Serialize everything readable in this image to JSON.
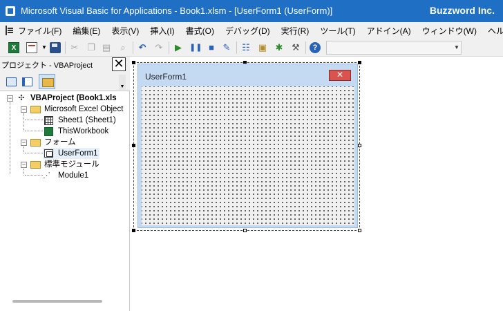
{
  "window": {
    "title": "Microsoft Visual Basic for Applications - Book1.xlsm - [UserForm1 (UserForm)]",
    "brand": "Buzzword Inc."
  },
  "menu": {
    "items": [
      {
        "label": "ファイル(F)"
      },
      {
        "label": "編集(E)"
      },
      {
        "label": "表示(V)"
      },
      {
        "label": "挿入(I)"
      },
      {
        "label": "書式(O)"
      },
      {
        "label": "デバッグ(D)"
      },
      {
        "label": "実行(R)"
      },
      {
        "label": "ツール(T)"
      },
      {
        "label": "アドイン(A)"
      },
      {
        "label": "ウィンドウ(W)"
      },
      {
        "label": "ヘルプ(H)"
      }
    ]
  },
  "toolbar": {
    "icons": [
      "excel-icon",
      "insert-userform-icon",
      "save-icon",
      "cut-icon",
      "copy-icon",
      "paste-icon",
      "find-icon",
      "undo-icon",
      "redo-icon",
      "run-icon",
      "break-icon",
      "reset-icon",
      "design-mode-icon",
      "project-explorer-icon",
      "properties-icon",
      "object-browser-icon",
      "toolbox-icon",
      "help-icon"
    ],
    "excel_glyph": "X",
    "help_glyph": "?"
  },
  "project": {
    "header": "プロジェクト - VBAProject",
    "close_glyph": "✕",
    "tree": {
      "root": "VBAProject (Book1.xls",
      "excel_objects": "Microsoft Excel Object",
      "sheet1": "Sheet1 (Sheet1)",
      "thisworkbook": "ThisWorkbook",
      "forms": "フォーム",
      "userform1": "UserForm1",
      "modules": "標準モジュール",
      "module1": "Module1"
    }
  },
  "userform": {
    "caption": "UserForm1",
    "close_glyph": "✕"
  }
}
